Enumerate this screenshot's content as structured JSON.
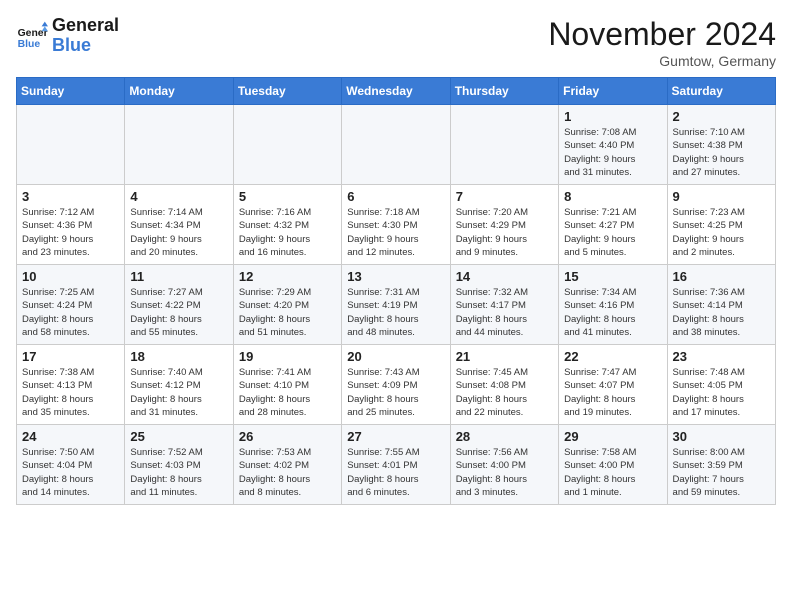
{
  "logo": {
    "text_general": "General",
    "text_blue": "Blue"
  },
  "title": "November 2024",
  "location": "Gumtow, Germany",
  "weekdays": [
    "Sunday",
    "Monday",
    "Tuesday",
    "Wednesday",
    "Thursday",
    "Friday",
    "Saturday"
  ],
  "weeks": [
    [
      {
        "day": "",
        "detail": ""
      },
      {
        "day": "",
        "detail": ""
      },
      {
        "day": "",
        "detail": ""
      },
      {
        "day": "",
        "detail": ""
      },
      {
        "day": "",
        "detail": ""
      },
      {
        "day": "1",
        "detail": "Sunrise: 7:08 AM\nSunset: 4:40 PM\nDaylight: 9 hours\nand 31 minutes."
      },
      {
        "day": "2",
        "detail": "Sunrise: 7:10 AM\nSunset: 4:38 PM\nDaylight: 9 hours\nand 27 minutes."
      }
    ],
    [
      {
        "day": "3",
        "detail": "Sunrise: 7:12 AM\nSunset: 4:36 PM\nDaylight: 9 hours\nand 23 minutes."
      },
      {
        "day": "4",
        "detail": "Sunrise: 7:14 AM\nSunset: 4:34 PM\nDaylight: 9 hours\nand 20 minutes."
      },
      {
        "day": "5",
        "detail": "Sunrise: 7:16 AM\nSunset: 4:32 PM\nDaylight: 9 hours\nand 16 minutes."
      },
      {
        "day": "6",
        "detail": "Sunrise: 7:18 AM\nSunset: 4:30 PM\nDaylight: 9 hours\nand 12 minutes."
      },
      {
        "day": "7",
        "detail": "Sunrise: 7:20 AM\nSunset: 4:29 PM\nDaylight: 9 hours\nand 9 minutes."
      },
      {
        "day": "8",
        "detail": "Sunrise: 7:21 AM\nSunset: 4:27 PM\nDaylight: 9 hours\nand 5 minutes."
      },
      {
        "day": "9",
        "detail": "Sunrise: 7:23 AM\nSunset: 4:25 PM\nDaylight: 9 hours\nand 2 minutes."
      }
    ],
    [
      {
        "day": "10",
        "detail": "Sunrise: 7:25 AM\nSunset: 4:24 PM\nDaylight: 8 hours\nand 58 minutes."
      },
      {
        "day": "11",
        "detail": "Sunrise: 7:27 AM\nSunset: 4:22 PM\nDaylight: 8 hours\nand 55 minutes."
      },
      {
        "day": "12",
        "detail": "Sunrise: 7:29 AM\nSunset: 4:20 PM\nDaylight: 8 hours\nand 51 minutes."
      },
      {
        "day": "13",
        "detail": "Sunrise: 7:31 AM\nSunset: 4:19 PM\nDaylight: 8 hours\nand 48 minutes."
      },
      {
        "day": "14",
        "detail": "Sunrise: 7:32 AM\nSunset: 4:17 PM\nDaylight: 8 hours\nand 44 minutes."
      },
      {
        "day": "15",
        "detail": "Sunrise: 7:34 AM\nSunset: 4:16 PM\nDaylight: 8 hours\nand 41 minutes."
      },
      {
        "day": "16",
        "detail": "Sunrise: 7:36 AM\nSunset: 4:14 PM\nDaylight: 8 hours\nand 38 minutes."
      }
    ],
    [
      {
        "day": "17",
        "detail": "Sunrise: 7:38 AM\nSunset: 4:13 PM\nDaylight: 8 hours\nand 35 minutes."
      },
      {
        "day": "18",
        "detail": "Sunrise: 7:40 AM\nSunset: 4:12 PM\nDaylight: 8 hours\nand 31 minutes."
      },
      {
        "day": "19",
        "detail": "Sunrise: 7:41 AM\nSunset: 4:10 PM\nDaylight: 8 hours\nand 28 minutes."
      },
      {
        "day": "20",
        "detail": "Sunrise: 7:43 AM\nSunset: 4:09 PM\nDaylight: 8 hours\nand 25 minutes."
      },
      {
        "day": "21",
        "detail": "Sunrise: 7:45 AM\nSunset: 4:08 PM\nDaylight: 8 hours\nand 22 minutes."
      },
      {
        "day": "22",
        "detail": "Sunrise: 7:47 AM\nSunset: 4:07 PM\nDaylight: 8 hours\nand 19 minutes."
      },
      {
        "day": "23",
        "detail": "Sunrise: 7:48 AM\nSunset: 4:05 PM\nDaylight: 8 hours\nand 17 minutes."
      }
    ],
    [
      {
        "day": "24",
        "detail": "Sunrise: 7:50 AM\nSunset: 4:04 PM\nDaylight: 8 hours\nand 14 minutes."
      },
      {
        "day": "25",
        "detail": "Sunrise: 7:52 AM\nSunset: 4:03 PM\nDaylight: 8 hours\nand 11 minutes."
      },
      {
        "day": "26",
        "detail": "Sunrise: 7:53 AM\nSunset: 4:02 PM\nDaylight: 8 hours\nand 8 minutes."
      },
      {
        "day": "27",
        "detail": "Sunrise: 7:55 AM\nSunset: 4:01 PM\nDaylight: 8 hours\nand 6 minutes."
      },
      {
        "day": "28",
        "detail": "Sunrise: 7:56 AM\nSunset: 4:00 PM\nDaylight: 8 hours\nand 3 minutes."
      },
      {
        "day": "29",
        "detail": "Sunrise: 7:58 AM\nSunset: 4:00 PM\nDaylight: 8 hours\nand 1 minute."
      },
      {
        "day": "30",
        "detail": "Sunrise: 8:00 AM\nSunset: 3:59 PM\nDaylight: 7 hours\nand 59 minutes."
      }
    ]
  ]
}
